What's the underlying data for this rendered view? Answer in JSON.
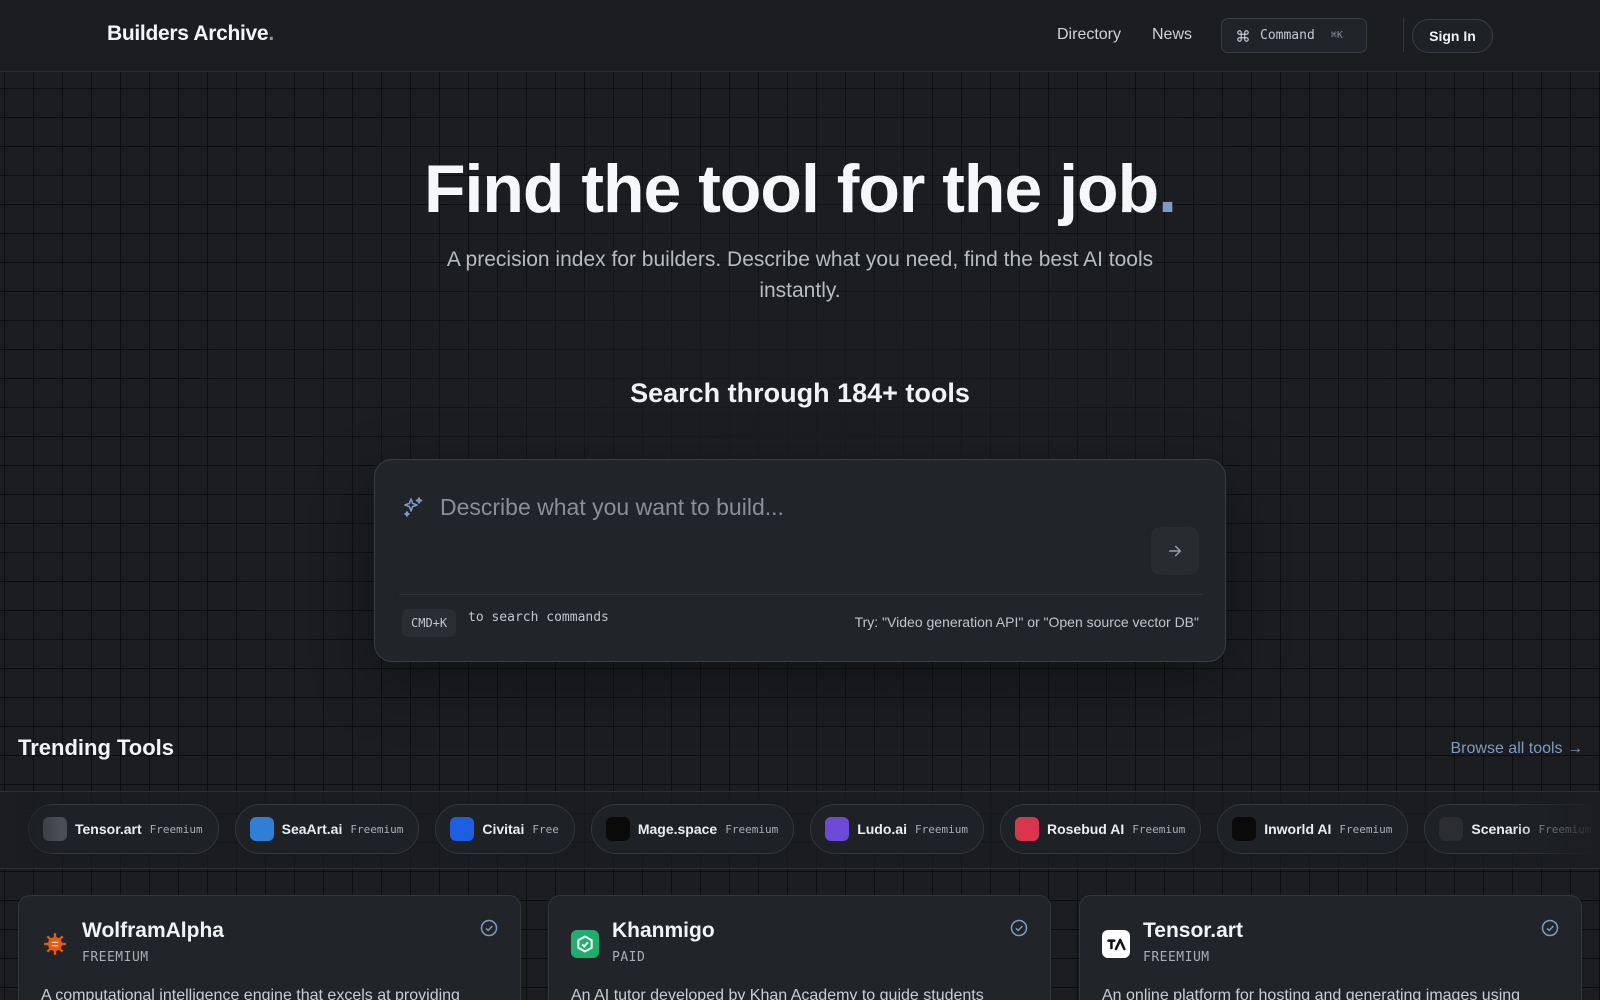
{
  "header": {
    "logo_text": "Builders Archive",
    "logo_dot": ".",
    "nav": [
      "Directory",
      "News"
    ],
    "command_label": "Command",
    "command_kbd": "⌘K",
    "signin_label": "Sign In"
  },
  "hero": {
    "title": "Find the tool for the job",
    "title_dot": ".",
    "subtitle": "A precision index for builders. Describe what you need, find the best AI tools instantly.",
    "search_count": "Search through 184+ tools"
  },
  "search": {
    "placeholder": "Describe what you want to build...",
    "kbd": "CMD+K",
    "kbd_suffix": "to search commands",
    "try_text": "Try: \"Video generation API\" or \"Open source vector DB\""
  },
  "trending": {
    "title": "Trending Tools",
    "browse_label": "Browse all tools →",
    "chips": [
      {
        "name": "Tensor.art",
        "tier": "Freemium",
        "icon": "tensor-art-logo",
        "color": "#4a4d53",
        "glyph": "TA"
      },
      {
        "name": "SeaArt.ai",
        "tier": "Freemium",
        "icon": "seaart-logo",
        "color": "#2f7fd6",
        "glyph": "S"
      },
      {
        "name": "Civitai",
        "tier": "Free",
        "icon": "civitai-logo",
        "color": "#1d5fe0",
        "glyph": "C"
      },
      {
        "name": "Mage.space",
        "tier": "Freemium",
        "icon": "mage-space-logo",
        "color": "#0a0a0a",
        "glyph": "m"
      },
      {
        "name": "Ludo.ai",
        "tier": "Freemium",
        "icon": "ludo-ai-logo",
        "color": "#6d4ad6",
        "glyph": "L"
      },
      {
        "name": "Rosebud AI",
        "tier": "Freemium",
        "icon": "rosebud-ai-logo",
        "color": "#d9364b",
        "glyph": "R"
      },
      {
        "name": "Inworld AI",
        "tier": "Freemium",
        "icon": "inworld-ai-logo",
        "color": "#0a0a0a",
        "glyph": "I"
      },
      {
        "name": "Scenario",
        "tier": "Freemium",
        "icon": "scenario-logo",
        "color": "#2b2d31",
        "glyph": "S"
      }
    ]
  },
  "tools": [
    {
      "name": "WolframAlpha",
      "tier": "FREEMIUM",
      "description": "A computational intelligence engine that excels at providing",
      "icon": "wolframalpha-logo",
      "color": "#e35d12"
    },
    {
      "name": "Khanmigo",
      "tier": "PAID",
      "description": "An AI tutor developed by Khan Academy to guide students",
      "icon": "khanmigo-logo",
      "color": "#1fae6d"
    },
    {
      "name": "Tensor.art",
      "tier": "FREEMIUM",
      "description": "An online platform for hosting and generating images using",
      "icon": "tensor-art-logo",
      "color": "#ffffff"
    }
  ],
  "colors": {
    "accent": "#7f9cc0",
    "background": "#1b1d21"
  }
}
